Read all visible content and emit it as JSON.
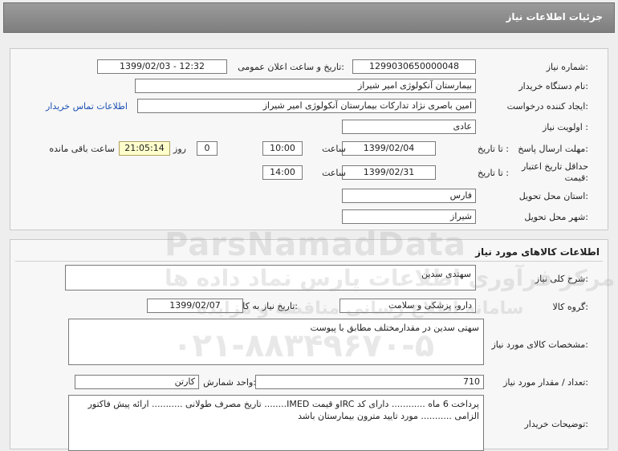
{
  "header": {
    "title": "جزئیات اطلاعات نیاز"
  },
  "need": {
    "number_label": "شماره نیاز:",
    "number": "1299030650000048",
    "announce_label": "تاریخ و ساعت اعلان عمومی:",
    "announce": "1399/02/03 - 12:32",
    "buyer_label": "نام دستگاه خریدار:",
    "buyer": "بیمارستان آنکولوژی امیر شیراز",
    "creator_label": "ایجاد کننده درخواست:",
    "creator": "امین باصری نژاد تدارکات بیمارستان آنکولوژی امیر شیراز",
    "contact_link": "اطلاعات تماس خریدار",
    "priority_label": "اولویت نیاز :",
    "priority": "عادی",
    "deadline_label": "مهلت ارسال پاسخ:",
    "until_date_label": "تا تاریخ :",
    "deadline_date": "1399/02/04",
    "time_label": "ساعت",
    "deadline_time": "10:00",
    "days_value": "0",
    "day_and_label": "روز و",
    "remaining": "21:05:14",
    "remaining_label": "ساعت باقی مانده",
    "validity_label": "حداقل تاریخ اعتبار قیمت:",
    "validity_date": "1399/02/31",
    "validity_time": "14:00",
    "province_label": "استان محل تحویل:",
    "province": "فارس",
    "city_label": "شهر محل تحویل:",
    "city": "شیراز"
  },
  "goods": {
    "title": "اطلاعات کالاهای مورد نیاز",
    "summary_label": "شرح کلی نیاز:",
    "summary": "سهتدی سدین",
    "group_label": "گروه کالا:",
    "group": "دارو، پزشکی و سلامت",
    "need_date_label": "تاریخ نیاز به کالا:",
    "need_date": "1399/02/07",
    "spec_label": "مشخصات کالای مورد نیاز:",
    "spec": "سهتی سدین در مقدارمختلف مطابق با پیوست",
    "qty_label": "تعداد / مقدار مورد نیاز:",
    "qty": "710",
    "unit_label": "واحد شمارش:",
    "unit": "کارتن",
    "notes_label": "توضیحات خریدار:",
    "notes": "پرداخت 6 ماه ............ دارای کد IRCو قیمت IMED........ تاریخ مصرف طولانی ........... ارائه پیش فاکتور الزامی ........... مورد تایید مترون بیمارستان باشد"
  },
  "watermark": {
    "brand": "ParsNamadData",
    "line1": "مرکز فرآوری اطلاعات پارس نماد داده ها",
    "line2": "سامانه اطلاع رسانی مناقصه و مزایده",
    "phone": "۰۲۱-۸۸۳۴۹۶۷۰-۵"
  },
  "colors": {
    "header_bg": "#8a8a8a",
    "link": "#1a4fb3",
    "timer_bg": "#ffffcc"
  }
}
